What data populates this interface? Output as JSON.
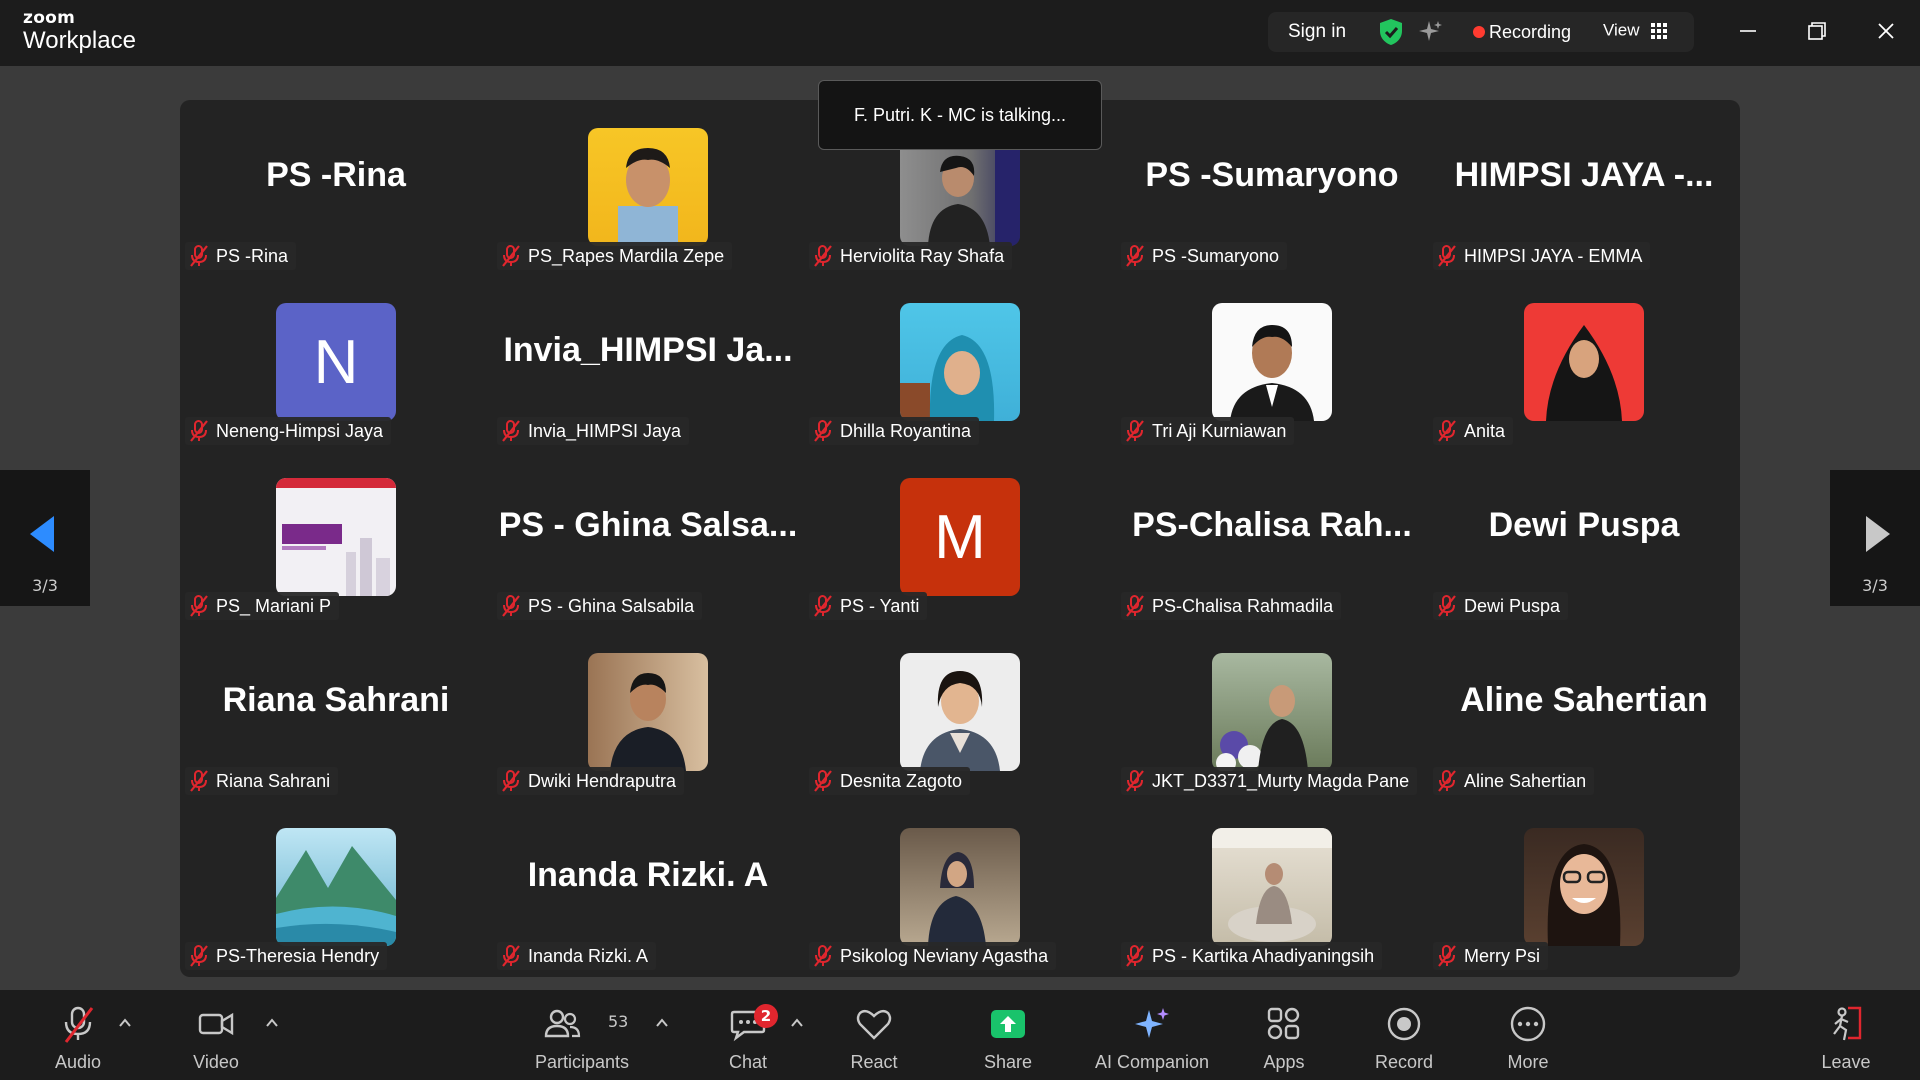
{
  "app": {
    "brand_small": "zoom",
    "brand_name": "Workplace"
  },
  "topbar": {
    "sign_in": "Sign in",
    "recording": "Recording",
    "view": "View"
  },
  "talking_banner": "F. Putri. K - MC is talking...",
  "pager": {
    "left_page": "3/3",
    "right_page": "3/3"
  },
  "tiles": [
    {
      "big": "PS -Rina",
      "label": "PS -Rina"
    },
    {
      "avatar": "photo",
      "label": "PS_Rapes Mardila Zepe"
    },
    {
      "avatar": "photo",
      "label": "Herviolita Ray Shafa"
    },
    {
      "big": "PS -Sumaryono",
      "label": "PS -Sumaryono"
    },
    {
      "big": "HIMPSI JAYA -...",
      "label": "HIMPSI JAYA - EMMA"
    },
    {
      "letter": "N",
      "label": "Neneng-Himpsi Jaya"
    },
    {
      "big": "Invia_HIMPSI Ja...",
      "label": "Invia_HIMPSI Jaya"
    },
    {
      "avatar": "photo",
      "label": "Dhilla Royantina"
    },
    {
      "avatar": "photo",
      "label": "Tri Aji Kurniawan"
    },
    {
      "avatar": "photo",
      "label": "Anita"
    },
    {
      "avatar": "poster",
      "label": "PS_ Mariani P"
    },
    {
      "big": "PS - Ghina Salsa...",
      "label": "PS - Ghina Salsabila"
    },
    {
      "letter": "M",
      "label": "PS - Yanti"
    },
    {
      "big": "PS-Chalisa Rah...",
      "label": "PS-Chalisa Rahmadila"
    },
    {
      "big": "Dewi Puspa",
      "label": "Dewi Puspa"
    },
    {
      "big": "Riana Sahrani",
      "label": "Riana Sahrani"
    },
    {
      "avatar": "photo",
      "label": "Dwiki Hendraputra"
    },
    {
      "avatar": "photo",
      "label": "Desnita Zagoto"
    },
    {
      "avatar": "photo",
      "label": "JKT_D3371_Murty Magda Pane"
    },
    {
      "big": "Aline Sahertian",
      "label": "Aline Sahertian"
    },
    {
      "avatar": "landscape",
      "label": "PS-Theresia Hendry"
    },
    {
      "big": "Inanda Rizki. A",
      "label": "Inanda Rizki. A"
    },
    {
      "avatar": "photo",
      "label": "Psikolog Neviany Agastha"
    },
    {
      "avatar": "photo",
      "label": "PS - Kartika Ahadiyaningsih"
    },
    {
      "avatar": "photo",
      "label": "Merry Psi"
    }
  ],
  "toolbar": {
    "audio": "Audio",
    "video": "Video",
    "participants": "Participants",
    "participants_count": "53",
    "chat": "Chat",
    "chat_badge": "2",
    "react": "React",
    "share": "Share",
    "ai_companion": "AI Companion",
    "apps": "Apps",
    "record": "Record",
    "more": "More",
    "leave": "Leave"
  },
  "colors": {
    "accent_share": "#19c36b",
    "record_dot": "#ff3b30",
    "mute_red": "#e0262e",
    "shield_green": "#22c55e",
    "pager_blue": "#2d8cff"
  }
}
